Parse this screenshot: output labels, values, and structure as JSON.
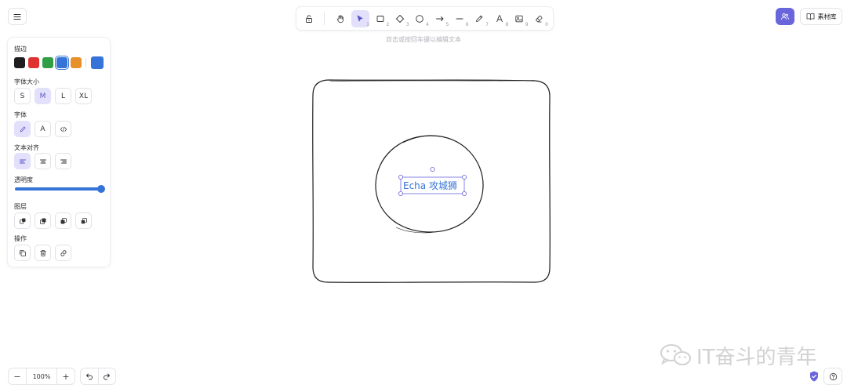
{
  "toolbar": {
    "hint": "双击或按回车键以编辑文本",
    "tools": [
      {
        "name": "lock",
        "key": ""
      },
      {
        "name": "hand",
        "key": ""
      },
      {
        "name": "selection",
        "key": "1"
      },
      {
        "name": "rectangle",
        "key": "2"
      },
      {
        "name": "diamond",
        "key": "3"
      },
      {
        "name": "ellipse",
        "key": "4"
      },
      {
        "name": "arrow",
        "key": "5"
      },
      {
        "name": "line",
        "key": "6"
      },
      {
        "name": "draw",
        "key": "7"
      },
      {
        "name": "text",
        "key": "8"
      },
      {
        "name": "image",
        "key": "9"
      },
      {
        "name": "eraser",
        "key": "0"
      }
    ]
  },
  "top_right": {
    "library_label": "素材库"
  },
  "panel": {
    "stroke_label": "描边",
    "stroke_colors": [
      "#1e1e1e",
      "#e03131",
      "#2f9e44",
      "#3573d9",
      "#e8912c"
    ],
    "current_color": "#3573d9",
    "font_size_label": "字体大小",
    "font_sizes": [
      "S",
      "M",
      "L",
      "XL"
    ],
    "font_family_label": "字体",
    "font_family_options": [
      "A"
    ],
    "text_align_label": "文本对齐",
    "opacity_label": "透明度",
    "opacity_value": 100,
    "layers_label": "图层",
    "actions_label": "操作"
  },
  "canvas": {
    "text": "Echa 攻城狮"
  },
  "bottom": {
    "zoom": "100%",
    "zoom_out": "−",
    "zoom_in": "+"
  },
  "watermark": {
    "text": "IT奋斗的青年"
  },
  "colors": {
    "accent": "#6965db",
    "selection": "#e2e0fb",
    "text_blue": "#3573d9"
  }
}
